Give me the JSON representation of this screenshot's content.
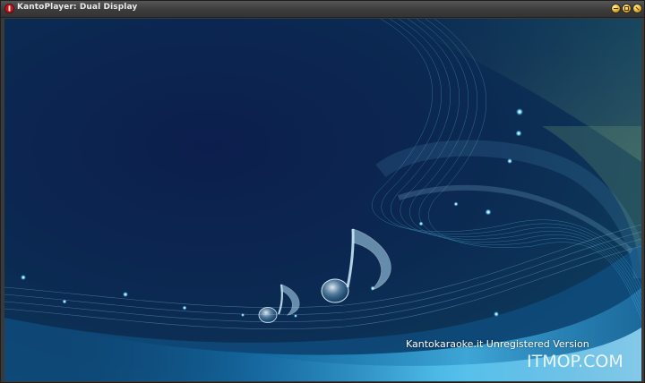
{
  "window": {
    "title": "KantoPlayer: Dual Display",
    "icon": "kanto-app-icon",
    "controls": [
      "minimize-icon",
      "maximize-icon",
      "close-icon"
    ]
  },
  "stage": {
    "version_text": "Kantokaraoke.it Unregistered Version",
    "watermark": "ITMOP.COM",
    "colors": {
      "background_dark": "#0b1f47",
      "wave_light": "#6fd3ff",
      "wave_mid": "#1e88c8",
      "accent_green": "#7fae7a"
    },
    "decoration": [
      "music-notes-graphic",
      "light-waves",
      "sparkles"
    ]
  }
}
